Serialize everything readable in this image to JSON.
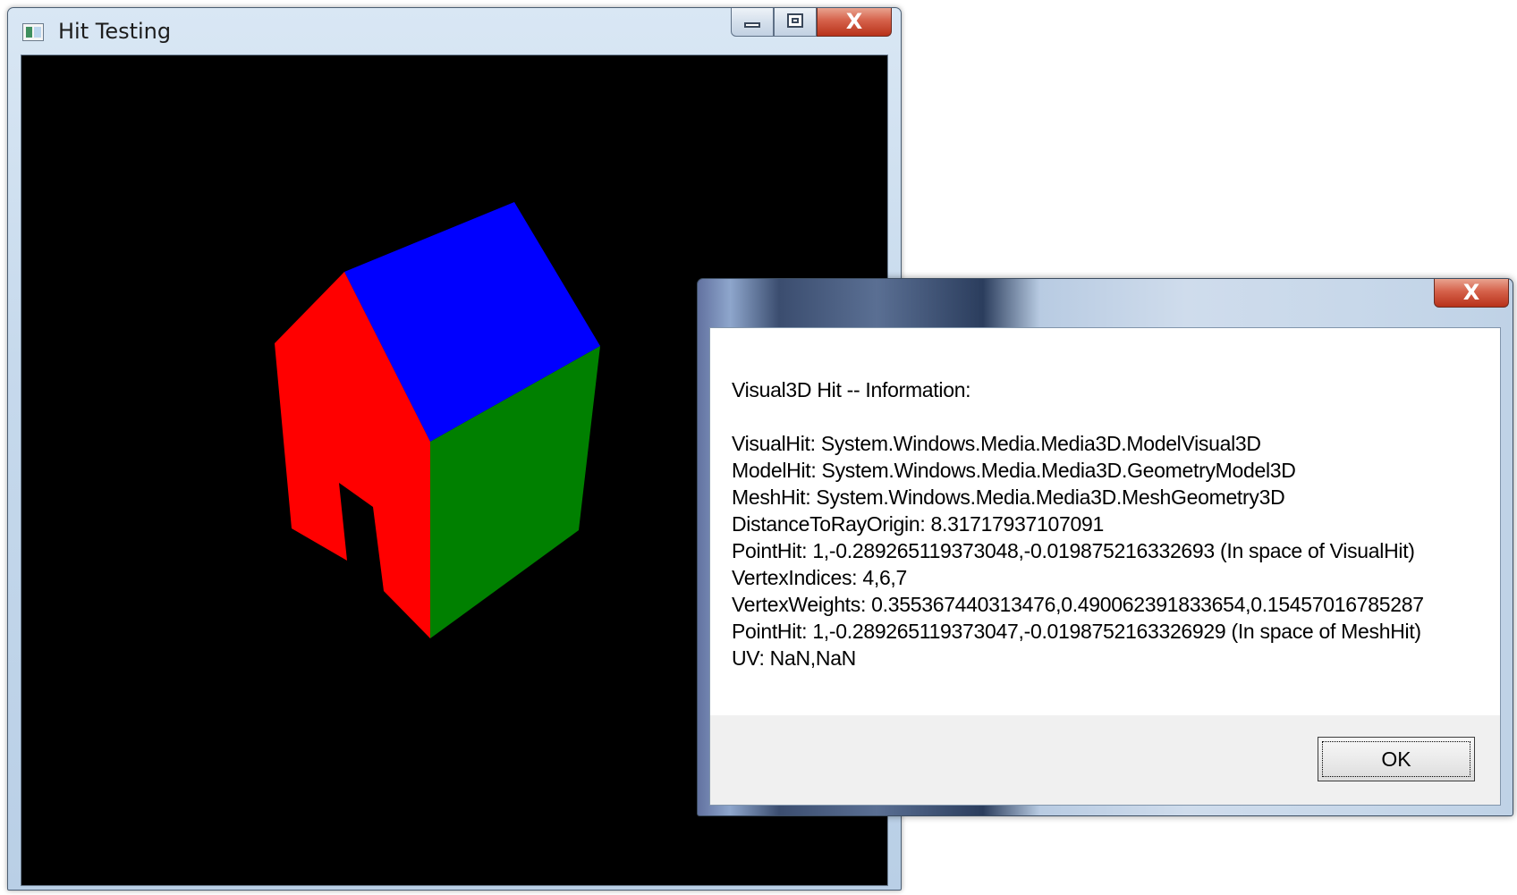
{
  "main_window": {
    "title": "Hit Testing",
    "icon": "app-window-icon",
    "caption_buttons": [
      "minimize-icon",
      "restore-icon",
      "close-icon"
    ],
    "close_glyph": "X",
    "scene": {
      "background_color": "#000000",
      "roof_color": "#0000ff",
      "front_color": "#ff0000",
      "side_color": "#008000"
    }
  },
  "dialog": {
    "close_glyph": "X",
    "heading": "Visual3D Hit -- Information:",
    "lines": [
      "VisualHit: System.Windows.Media.Media3D.ModelVisual3D",
      "ModelHit: System.Windows.Media.Media3D.GeometryModel3D",
      "MeshHit: System.Windows.Media.Media3D.MeshGeometry3D",
      "DistanceToRayOrigin: 8.31717937107091",
      "PointHit: 1,-0.289265119373048,-0.019875216332693 (In space of VisualHit)",
      "VertexIndices: 4,6,7",
      "VertexWeights: 0.355367440313476,0.490062391833654,0.15457016785287",
      "PointHit: 1,-0.289265119373047,-0.0198752163326929 (In space of MeshHit)",
      "UV: NaN,NaN"
    ],
    "ok_label": "OK"
  }
}
